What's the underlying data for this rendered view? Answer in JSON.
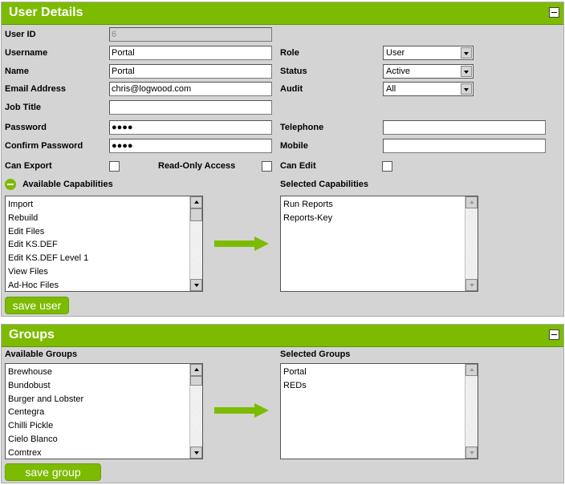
{
  "user_details": {
    "title": "User Details",
    "fields": {
      "user_id": {
        "label": "User ID",
        "value": "6"
      },
      "username": {
        "label": "Username",
        "value": "Portal"
      },
      "name": {
        "label": "Name",
        "value": "Portal"
      },
      "email": {
        "label": "Email Address",
        "value": "chris@logwood.com"
      },
      "job_title": {
        "label": "Job Title",
        "value": ""
      },
      "password": {
        "label": "Password",
        "value": "●●●●"
      },
      "confirm_password": {
        "label": "Confirm Password",
        "value": "●●●●"
      },
      "role": {
        "label": "Role",
        "value": "User"
      },
      "status": {
        "label": "Status",
        "value": "Active"
      },
      "audit": {
        "label": "Audit",
        "value": "All"
      },
      "telephone": {
        "label": "Telephone",
        "value": ""
      },
      "mobile": {
        "label": "Mobile",
        "value": ""
      }
    },
    "checkboxes": {
      "can_export": {
        "label": "Can Export",
        "checked": false
      },
      "read_only": {
        "label": "Read-Only Access",
        "checked": false
      },
      "can_edit": {
        "label": "Can Edit",
        "checked": false
      }
    },
    "available_capabilities": {
      "label": "Available Capabilities",
      "items": [
        "Import",
        "Rebuild",
        "Edit Files",
        "Edit KS.DEF",
        "Edit KS.DEF Level 1",
        "View Files",
        "Ad-Hoc Files"
      ]
    },
    "selected_capabilities": {
      "label": "Selected Capabilities",
      "items": [
        "Run Reports",
        "Reports-Key"
      ]
    },
    "save_label": "save user"
  },
  "groups": {
    "title": "Groups",
    "available": {
      "label": "Available Groups",
      "items": [
        "Brewhouse",
        "Bundobust",
        "Burger and Lobster",
        "Centegra",
        "Chilli Pickle",
        "Cielo Blanco",
        "Comtrex"
      ]
    },
    "selected": {
      "label": "Selected Groups",
      "items": [
        "Portal",
        "REDs"
      ]
    },
    "save_label": "save group"
  },
  "colors": {
    "accent": "#7cbb00",
    "panel_bg": "#d4d4d4"
  }
}
